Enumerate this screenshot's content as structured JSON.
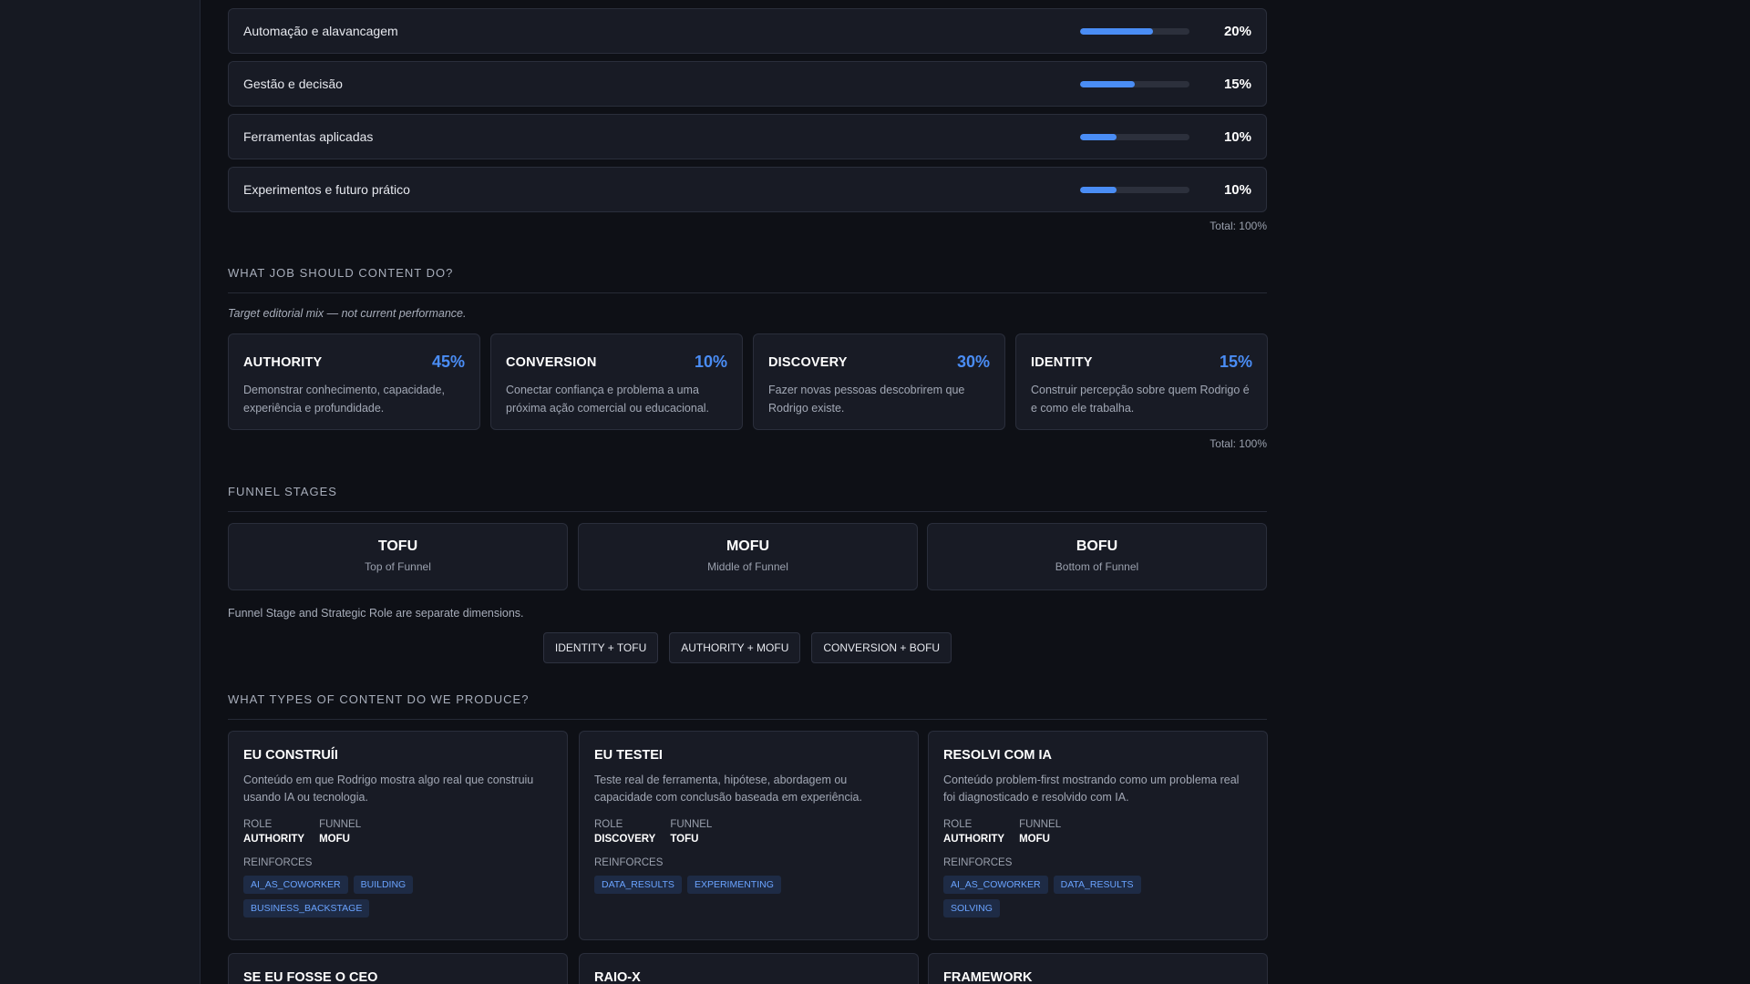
{
  "pillars": [
    {
      "label": "Automação e alavancagem",
      "pct": "20%",
      "fill": 0.67
    },
    {
      "label": "Gestão e decisão",
      "pct": "15%",
      "fill": 0.5
    },
    {
      "label": "Ferramentas aplicadas",
      "pct": "10%",
      "fill": 0.33
    },
    {
      "label": "Experimentos e futuro prático",
      "pct": "10%",
      "fill": 0.33
    }
  ],
  "pillars_total": "Total: 100%",
  "jobs": {
    "title": "WHAT JOB SHOULD CONTENT DO?",
    "note": "Target editorial mix — not current performance.",
    "roles": [
      {
        "name": "AUTHORITY",
        "pct": "45%",
        "desc": "Demonstrar conhecimento, capacidade, experiência e profundidade."
      },
      {
        "name": "CONVERSION",
        "pct": "10%",
        "desc": "Conectar confiança e problema a uma próxima ação comercial ou educacional."
      },
      {
        "name": "DISCOVERY",
        "pct": "30%",
        "desc": "Fazer novas pessoas descobrirem que Rodrigo existe."
      },
      {
        "name": "IDENTITY",
        "pct": "15%",
        "desc": "Construir percepção sobre quem Rodrigo é e como ele trabalha."
      }
    ],
    "total": "Total: 100%"
  },
  "funnel": {
    "title": "FUNNEL STAGES",
    "stages": [
      {
        "name": "TOFU",
        "sub": "Top of Funnel"
      },
      {
        "name": "MOFU",
        "sub": "Middle of Funnel"
      },
      {
        "name": "BOFU",
        "sub": "Bottom of Funnel"
      }
    ],
    "note": "Funnel Stage and Strategic Role are separate dimensions.",
    "combos": [
      "IDENTITY + TOFU",
      "AUTHORITY + MOFU",
      "CONVERSION + BOFU"
    ]
  },
  "types": {
    "title": "WHAT TYPES OF CONTENT DO WE PRODUCE?",
    "role_label": "ROLE",
    "funnel_label": "FUNNEL",
    "reinforces_label": "REINFORCES",
    "cards": [
      {
        "title": "EU CONSTRUÍI",
        "desc": "Conteúdo em que Rodrigo mostra algo real que construiu usando IA ou tecnologia.",
        "role": "AUTHORITY",
        "funnel": "MOFU",
        "tags": [
          "AI_AS_COWORKER",
          "BUILDING",
          "BUSINESS_BACKSTAGE"
        ]
      },
      {
        "title": "EU TESTEI",
        "desc": "Teste real de ferramenta, hipótese, abordagem ou capacidade com conclusão baseada em experiência.",
        "role": "DISCOVERY",
        "funnel": "TOFU",
        "tags": [
          "DATA_RESULTS",
          "EXPERIMENTING"
        ]
      },
      {
        "title": "RESOLVI COM IA",
        "desc": "Conteúdo problem-first mostrando como um problema real foi diagnosticado e resolvido com IA.",
        "role": "AUTHORITY",
        "funnel": "MOFU",
        "tags": [
          "AI_AS_COWORKER",
          "DATA_RESULTS",
          "SOLVING"
        ]
      }
    ],
    "next_titles": [
      "SE EU FOSSE O CEO",
      "RAIO-X",
      "FRAMEWORK"
    ]
  }
}
